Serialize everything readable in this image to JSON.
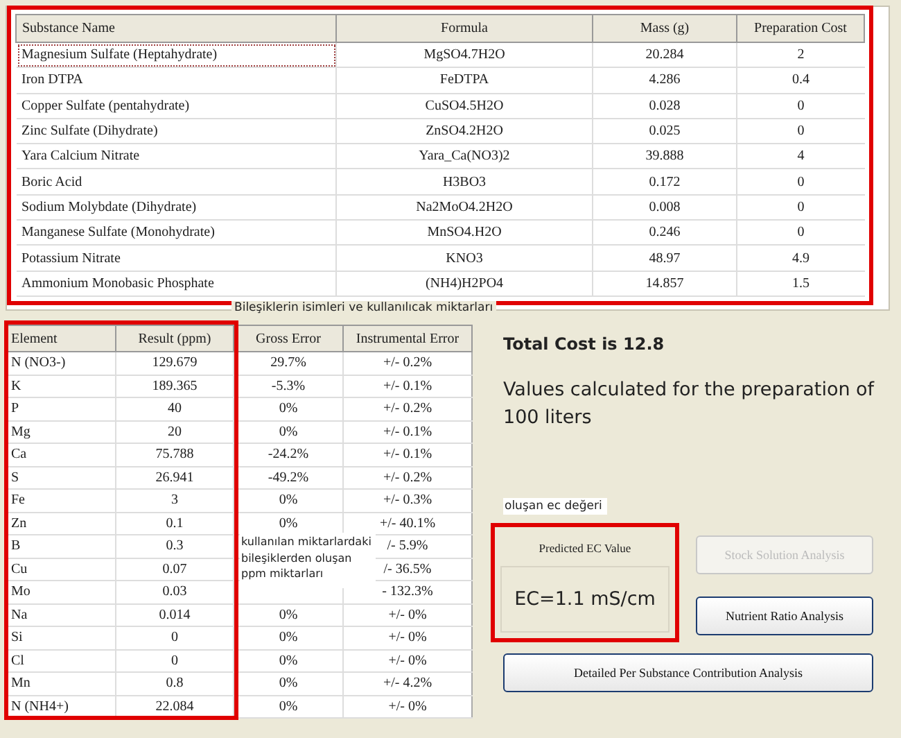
{
  "substances": {
    "columns": [
      "Substance Name",
      "Formula",
      "Mass (g)",
      "Preparation Cost"
    ],
    "rows": [
      {
        "name": "Magnesium Sulfate (Heptahydrate)",
        "formula": "MgSO4.7H2O",
        "mass": "20.284",
        "cost": "2",
        "selected": true
      },
      {
        "name": "Iron DTPA",
        "formula": "FeDTPA",
        "mass": "4.286",
        "cost": "0.4",
        "selected": false
      },
      {
        "name": "Copper Sulfate (pentahydrate)",
        "formula": "CuSO4.5H2O",
        "mass": "0.028",
        "cost": "0",
        "selected": false
      },
      {
        "name": "Zinc Sulfate (Dihydrate)",
        "formula": "ZnSO4.2H2O",
        "mass": "0.025",
        "cost": "0",
        "selected": false
      },
      {
        "name": "Yara Calcium Nitrate",
        "formula": "Yara_Ca(NO3)2",
        "mass": "39.888",
        "cost": "4",
        "selected": false
      },
      {
        "name": "Boric Acid",
        "formula": "H3BO3",
        "mass": "0.172",
        "cost": "0",
        "selected": false
      },
      {
        "name": "Sodium Molybdate (Dihydrate)",
        "formula": "Na2MoO4.2H2O",
        "mass": "0.008",
        "cost": "0",
        "selected": false
      },
      {
        "name": "Manganese Sulfate (Monohydrate)",
        "formula": "MnSO4.H2O",
        "mass": "0.246",
        "cost": "0",
        "selected": false
      },
      {
        "name": "Potassium Nitrate",
        "formula": "KNO3",
        "mass": "48.97",
        "cost": "4.9",
        "selected": false
      },
      {
        "name": "Ammonium Monobasic Phosphate",
        "formula": "(NH4)H2PO4",
        "mass": "14.857",
        "cost": "1.5",
        "selected": false
      }
    ]
  },
  "caption": "Bileşiklerin isimleri ve kullanılıcak miktarları",
  "elements": {
    "columns": [
      "Element",
      "Result (ppm)",
      "Gross Error",
      "Instrumental Error"
    ],
    "rows": [
      {
        "element": "N (NO3-)",
        "result": "129.679",
        "gross": "29.7%",
        "instrumental": "+/- 0.2%"
      },
      {
        "element": "K",
        "result": "189.365",
        "gross": "-5.3%",
        "instrumental": "+/- 0.1%"
      },
      {
        "element": "P",
        "result": "40",
        "gross": "0%",
        "instrumental": "+/- 0.2%"
      },
      {
        "element": "Mg",
        "result": "20",
        "gross": "0%",
        "instrumental": "+/- 0.1%"
      },
      {
        "element": "Ca",
        "result": "75.788",
        "gross": "-24.2%",
        "instrumental": "+/- 0.1%"
      },
      {
        "element": "S",
        "result": "26.941",
        "gross": "-49.2%",
        "instrumental": "+/- 0.2%"
      },
      {
        "element": "Fe",
        "result": "3",
        "gross": "0%",
        "instrumental": "+/- 0.3%"
      },
      {
        "element": "Zn",
        "result": "0.1",
        "gross": "0%",
        "instrumental": "+/- 40.1%"
      },
      {
        "element": "B",
        "result": "0.3",
        "instrumental": "/- 5.9%"
      },
      {
        "element": "Cu",
        "result": "0.07",
        "instrumental": "/- 36.5%"
      },
      {
        "element": "Mo",
        "result": "0.03",
        "instrumental": "- 132.3%"
      },
      {
        "element": "Na",
        "result": "0.014",
        "gross": "0%",
        "instrumental": "+/- 0%"
      },
      {
        "element": "Si",
        "result": "0",
        "gross": "0%",
        "instrumental": "+/- 0%"
      },
      {
        "element": "Cl",
        "result": "0",
        "gross": "0%",
        "instrumental": "+/- 0%"
      },
      {
        "element": "Mn",
        "result": "0.8",
        "gross": "0%",
        "instrumental": "+/- 4.2%"
      },
      {
        "element": "N (NH4+)",
        "result": "22.084",
        "gross": "0%",
        "instrumental": "+/- 0%"
      }
    ]
  },
  "annotation": "kullanılan miktarlardaki bileşiklerden oluşan ppm miktarları",
  "total_cost": "Total Cost is 12.8",
  "note": "Values calculated for the preparation of 100 liters",
  "ec_annotation": "oluşan ec değeri",
  "ec": {
    "title": "Predicted EC Value",
    "value": "EC=1.1 mS/cm"
  },
  "buttons": [
    {
      "label": "Stock Solution Analysis",
      "disabled": true
    },
    {
      "label": "Nutrient Ratio Analysis",
      "disabled": false
    },
    {
      "label": "Detailed Per Substance Contribution Analysis",
      "disabled": false
    }
  ]
}
